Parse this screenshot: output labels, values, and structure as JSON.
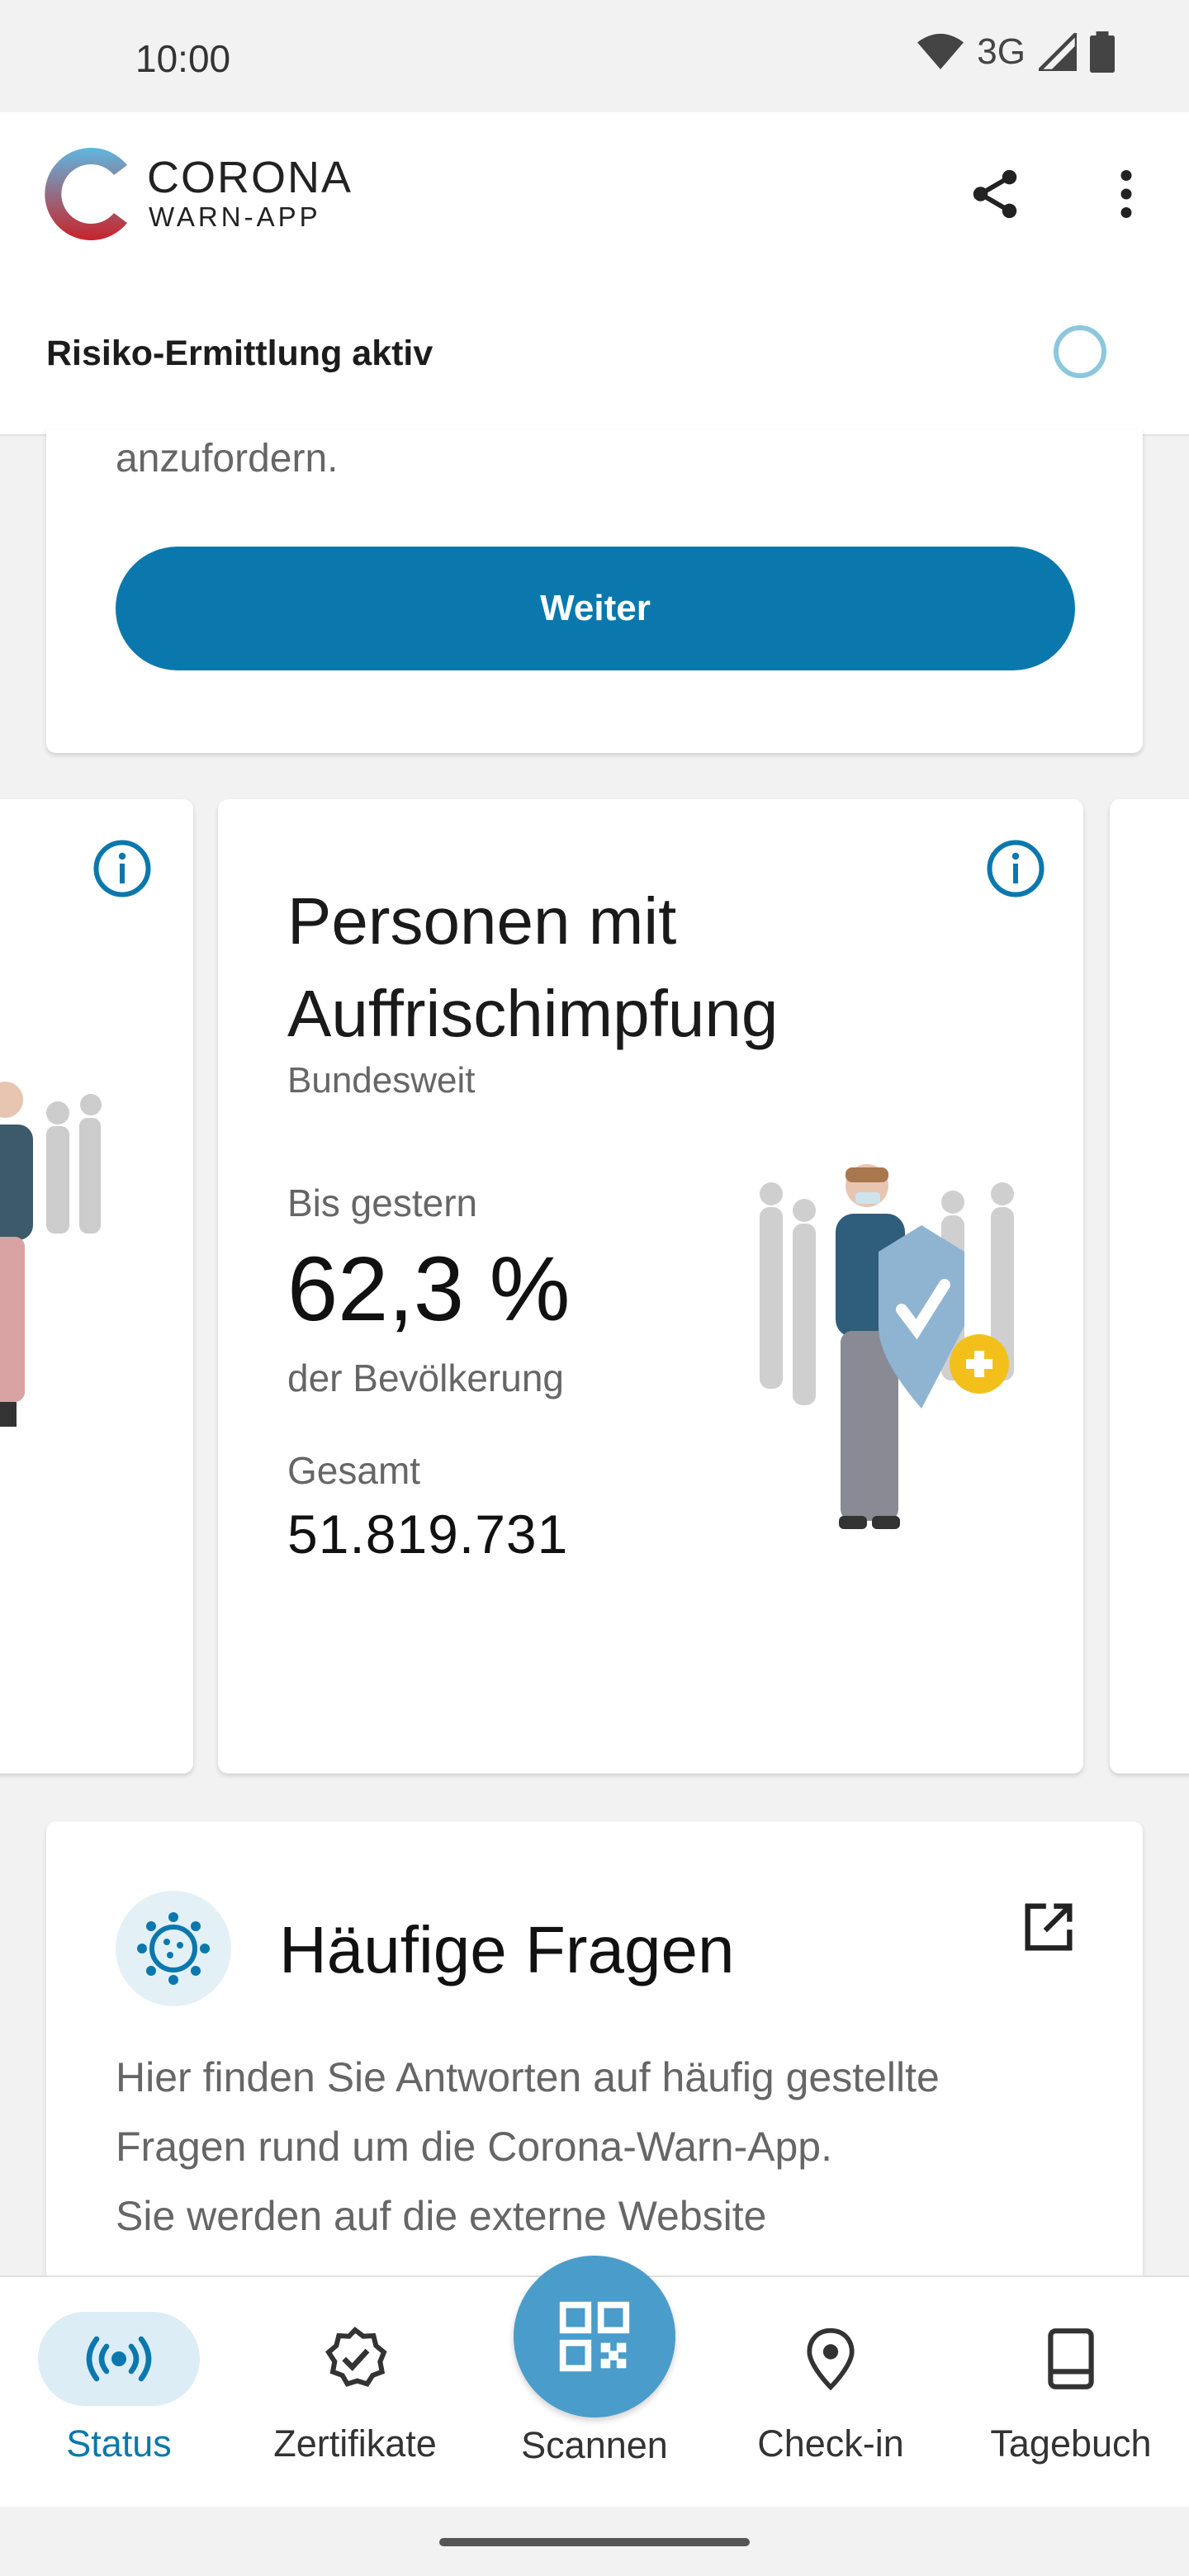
{
  "status_bar": {
    "time": "10:00",
    "network": "3G"
  },
  "header": {
    "brand_line1": "CORONA",
    "brand_line2": "WARN-APP",
    "risk_status": "Risiko-Ermittlung aktiv"
  },
  "top_card": {
    "tail_text": "anzufordern.",
    "button_label": "Weiter"
  },
  "stat_card": {
    "title": "Personen mit Auffrischimpfung",
    "subtitle": "Bundesweit",
    "label_yesterday": "Bis gestern",
    "value_percent": "62,3 %",
    "label_population": "der Bevölkerung",
    "label_total": "Gesamt",
    "value_total": "51.819.731"
  },
  "faq_card": {
    "title": "Häufige Fragen",
    "text_line1": "Hier finden Sie Antworten auf häufig gestellte",
    "text_line2": "Fragen rund um die Corona-Warn-App.",
    "text_line3": "Sie werden auf die externe Website"
  },
  "bottom_nav": {
    "status": "Status",
    "certificates": "Zertifikate",
    "scan": "Scannen",
    "checkin": "Check-in",
    "diary": "Tagebuch"
  },
  "colors": {
    "accent": "#0b78ad",
    "fab": "#4a9ccb",
    "active_pill": "#dcedf5"
  }
}
